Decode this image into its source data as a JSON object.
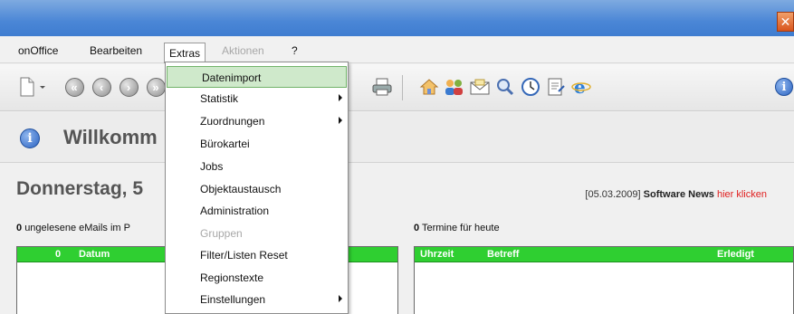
{
  "window": {
    "close_glyph": "✕"
  },
  "menubar": {
    "items": [
      {
        "label": "onOffice"
      },
      {
        "label": "Bearbeiten"
      },
      {
        "label": "Extras"
      },
      {
        "label": "Aktionen"
      },
      {
        "label": "?"
      }
    ]
  },
  "toolbar": {
    "icons": [
      "new-document-icon",
      "first-icon",
      "back-icon",
      "forward-icon",
      "print-icon",
      "home-icon",
      "contacts-icon",
      "mail-icon",
      "search-icon",
      "clock-icon",
      "notes-icon",
      "browser-icon",
      "info-icon"
    ]
  },
  "welcome": {
    "title": "Willkomm",
    "date": "Donnerstag, 5",
    "news_date": "[05.03.2009]",
    "news_label": "Software News",
    "news_link": "hier klicken"
  },
  "emails": {
    "count": "0",
    "label": "ungelesene eMails im P",
    "columns": [
      "0",
      "Datum"
    ]
  },
  "appointments": {
    "count": "0",
    "label": "Termine für heute",
    "columns": [
      "Uhrzeit",
      "Betreff",
      "Erledigt"
    ]
  },
  "extras_menu": {
    "items": [
      {
        "label": "Datenimport",
        "highlight": true
      },
      {
        "label": "Statistik",
        "submenu": true
      },
      {
        "label": "Zuordnungen",
        "submenu": true
      },
      {
        "label": "Bürokartei"
      },
      {
        "label": "Jobs"
      },
      {
        "label": "Objektaustausch"
      },
      {
        "label": "Administration"
      },
      {
        "label": "Gruppen",
        "disabled": true
      },
      {
        "label": "Filter/Listen Reset"
      },
      {
        "label": "Regionstexte"
      },
      {
        "label": "Einstellungen",
        "submenu": true
      }
    ]
  },
  "colors": {
    "accent_green": "#2fcf31",
    "highlight_green": "#cfe9cb",
    "link_red": "#e02020",
    "titlebar_blue": "#4a86d6"
  }
}
